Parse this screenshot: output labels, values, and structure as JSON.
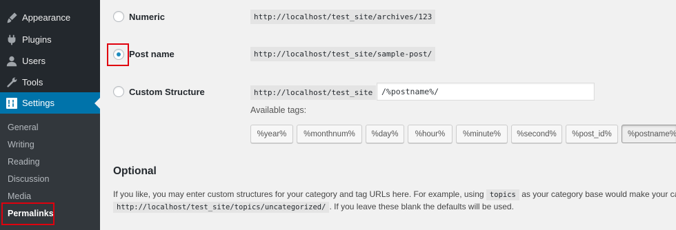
{
  "sidebar": {
    "items": [
      {
        "label": "Appearance",
        "icon": "paintbrush-icon",
        "active": false
      },
      {
        "label": "Plugins",
        "icon": "plug-icon",
        "active": false
      },
      {
        "label": "Users",
        "icon": "user-icon",
        "active": false
      },
      {
        "label": "Tools",
        "icon": "wrench-icon",
        "active": false
      },
      {
        "label": "Settings",
        "icon": "settings-icon",
        "active": true
      }
    ],
    "submenu": [
      "General",
      "Writing",
      "Reading",
      "Discussion",
      "Media",
      "Permalinks"
    ],
    "current_submenu": "Permalinks"
  },
  "permalink_options": {
    "numeric": {
      "label": "Numeric",
      "example": "http://localhost/test_site/archives/123",
      "checked": false
    },
    "post_name": {
      "label": "Post name",
      "example": "http://localhost/test_site/sample-post/",
      "checked": true
    },
    "custom": {
      "label": "Custom Structure",
      "base": "http://localhost/test_site",
      "value": "/%postname%/",
      "checked": false
    }
  },
  "available_tags_label": "Available tags:",
  "tags": [
    "%year%",
    "%monthnum%",
    "%day%",
    "%hour%",
    "%minute%",
    "%second%",
    "%post_id%",
    "%postname%"
  ],
  "optional": {
    "title": "Optional",
    "line1_start": "If you like, you may enter custom structures for your category and tag URLs here. For example, using",
    "line1_code": "topics",
    "line1_end": "as your category base would make your catego",
    "line2_code": "http://localhost/test_site/topics/uncategorized/",
    "line2_end": ". If you leave these blank the defaults will be used."
  },
  "colors": {
    "sidebar_bg": "#23282d",
    "active_bg": "#0073aa",
    "highlight": "#e0000e",
    "radio_dot": "#1e8cbe"
  }
}
